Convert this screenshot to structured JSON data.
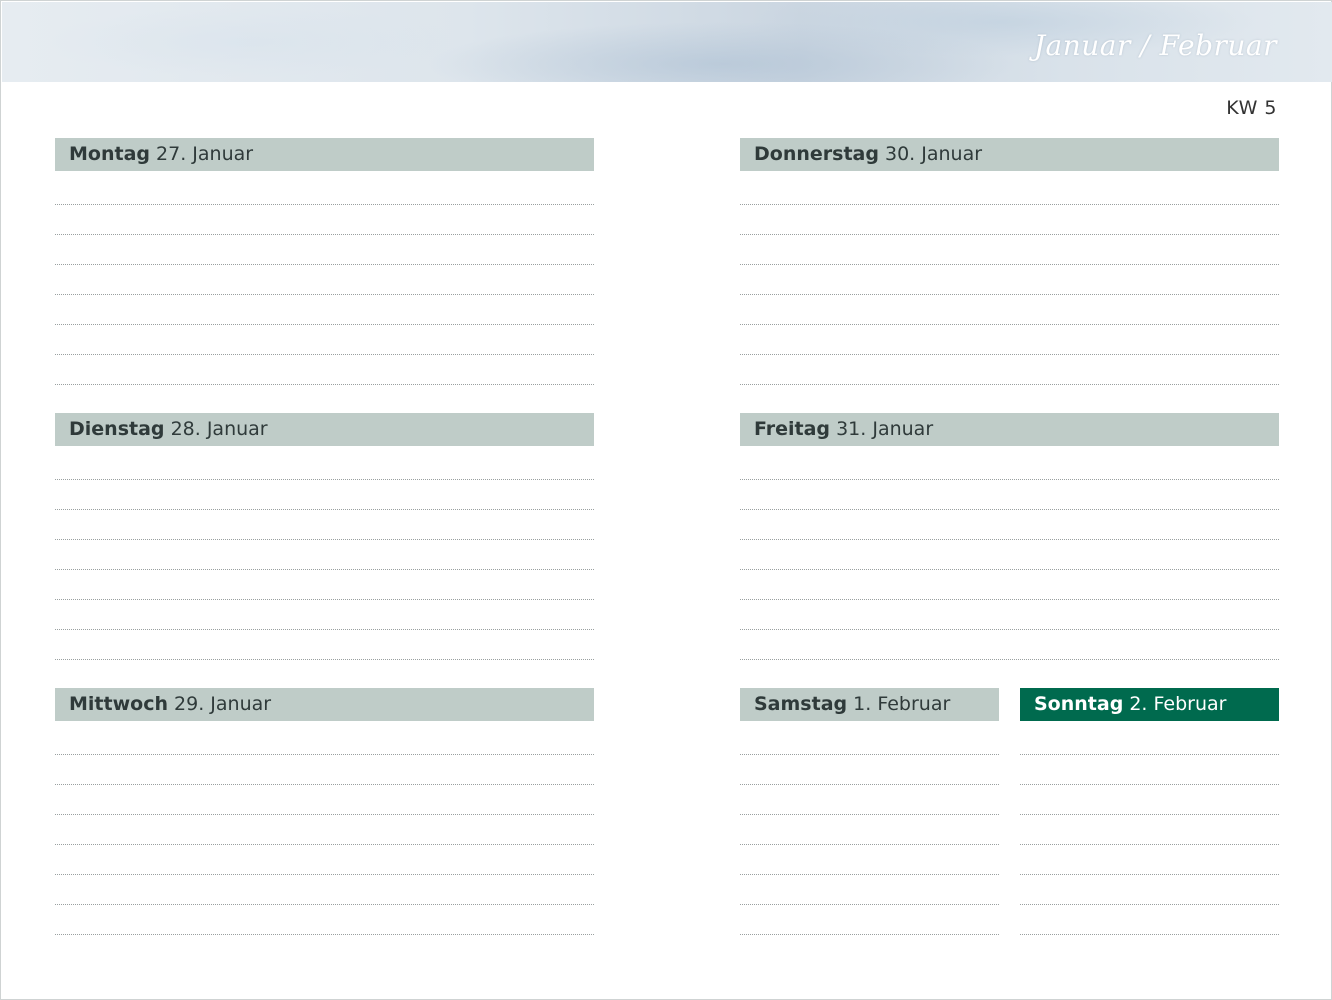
{
  "header": {
    "title": "Januar / Februar"
  },
  "week_label": "KW 5",
  "days": {
    "montag": {
      "weekday": "Montag",
      "date": "27. Januar"
    },
    "dienstag": {
      "weekday": "Dienstag",
      "date": "28. Januar"
    },
    "mittwoch": {
      "weekday": "Mittwoch",
      "date": "29. Januar"
    },
    "donnerstag": {
      "weekday": "Donnerstag",
      "date": "30. Januar"
    },
    "freitag": {
      "weekday": "Freitag",
      "date": "31. Januar"
    },
    "samstag": {
      "weekday": "Samstag",
      "date": "1. Februar"
    },
    "sonntag": {
      "weekday": "Sonntag",
      "date": "2. Februar"
    }
  },
  "colors": {
    "day_header_bg": "#bfccc8",
    "sunday_header_bg": "#006a4e",
    "dotted_line": "#9aa0a0"
  }
}
